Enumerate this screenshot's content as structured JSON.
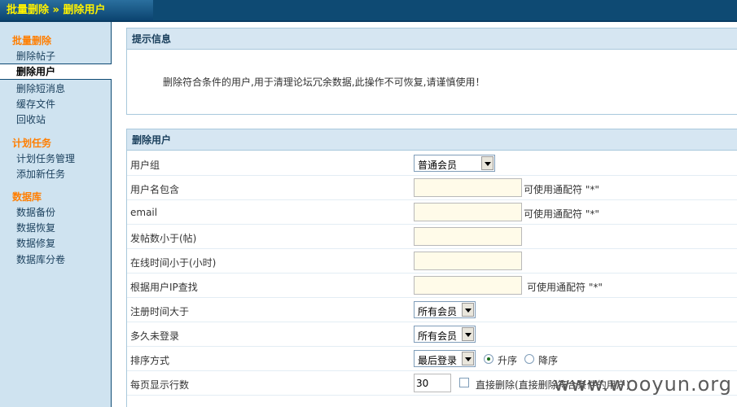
{
  "header": {
    "title": "批量删除 » 删除用户"
  },
  "sidebar": {
    "groups": [
      {
        "label": "批量删除",
        "items": [
          "删除帖子",
          "删除用户",
          "删除短消息",
          "缓存文件",
          "回收站"
        ]
      },
      {
        "label": "计划任务",
        "items": [
          "计划任务管理",
          "添加新任务"
        ]
      },
      {
        "label": "数据库",
        "items": [
          "数据备份",
          "数据恢复",
          "数据修复",
          "数据库分卷"
        ]
      }
    ],
    "active_item": "删除用户"
  },
  "notice": {
    "title": "提示信息",
    "text": "删除符合条件的用户,用于清理论坛冗余数据,此操作不可恢复,请谨慎使用！"
  },
  "form": {
    "title": "删除用户",
    "usergroup": {
      "label": "用户组",
      "value": "普通会员"
    },
    "username": {
      "label": "用户名包含",
      "value": "",
      "hint": "可使用通配符 \"*\""
    },
    "email": {
      "label": "email",
      "value": "",
      "hint": "可使用通配符 \"*\""
    },
    "posts": {
      "label": "发帖数小于(帖)",
      "value": ""
    },
    "online": {
      "label": "在线时间小于(小时)",
      "value": ""
    },
    "ip": {
      "label": "根据用户IP查找",
      "value": "",
      "hint": "可使用通配符 \"*\""
    },
    "regdate": {
      "label": "注册时间大于",
      "value": "所有会员"
    },
    "lastvisit": {
      "label": "多久未登录",
      "value": "所有会员"
    },
    "sort": {
      "label": "排序方式",
      "value": "最后登录",
      "asc": "升序",
      "desc": "降序",
      "selected": "升序"
    },
    "perpage": {
      "label": "每页显示行数",
      "value": "30",
      "direct_delete_label": "直接删除(直接删除符合条件的用户)"
    }
  },
  "watermark": "www.wooyun.org"
}
